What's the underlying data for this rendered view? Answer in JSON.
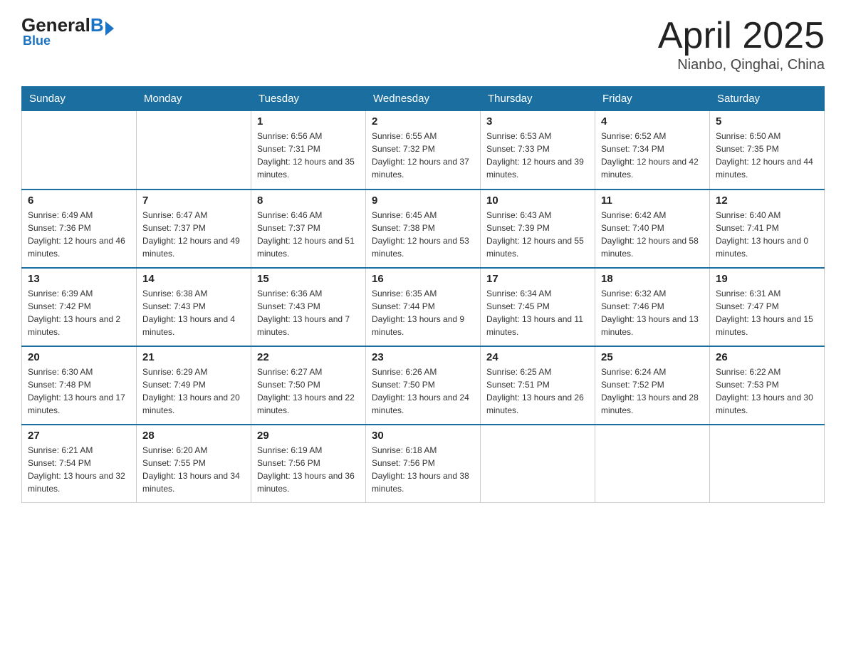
{
  "logo": {
    "name_black": "General",
    "name_blue": "Blue",
    "subtitle": "Blue"
  },
  "calendar": {
    "title": "April 2025",
    "subtitle": "Nianbo, Qinghai, China"
  },
  "headers": [
    "Sunday",
    "Monday",
    "Tuesday",
    "Wednesday",
    "Thursday",
    "Friday",
    "Saturday"
  ],
  "weeks": [
    [
      {
        "day": "",
        "sunrise": "",
        "sunset": "",
        "daylight": ""
      },
      {
        "day": "",
        "sunrise": "",
        "sunset": "",
        "daylight": ""
      },
      {
        "day": "1",
        "sunrise": "Sunrise: 6:56 AM",
        "sunset": "Sunset: 7:31 PM",
        "daylight": "Daylight: 12 hours and 35 minutes."
      },
      {
        "day": "2",
        "sunrise": "Sunrise: 6:55 AM",
        "sunset": "Sunset: 7:32 PM",
        "daylight": "Daylight: 12 hours and 37 minutes."
      },
      {
        "day": "3",
        "sunrise": "Sunrise: 6:53 AM",
        "sunset": "Sunset: 7:33 PM",
        "daylight": "Daylight: 12 hours and 39 minutes."
      },
      {
        "day": "4",
        "sunrise": "Sunrise: 6:52 AM",
        "sunset": "Sunset: 7:34 PM",
        "daylight": "Daylight: 12 hours and 42 minutes."
      },
      {
        "day": "5",
        "sunrise": "Sunrise: 6:50 AM",
        "sunset": "Sunset: 7:35 PM",
        "daylight": "Daylight: 12 hours and 44 minutes."
      }
    ],
    [
      {
        "day": "6",
        "sunrise": "Sunrise: 6:49 AM",
        "sunset": "Sunset: 7:36 PM",
        "daylight": "Daylight: 12 hours and 46 minutes."
      },
      {
        "day": "7",
        "sunrise": "Sunrise: 6:47 AM",
        "sunset": "Sunset: 7:37 PM",
        "daylight": "Daylight: 12 hours and 49 minutes."
      },
      {
        "day": "8",
        "sunrise": "Sunrise: 6:46 AM",
        "sunset": "Sunset: 7:37 PM",
        "daylight": "Daylight: 12 hours and 51 minutes."
      },
      {
        "day": "9",
        "sunrise": "Sunrise: 6:45 AM",
        "sunset": "Sunset: 7:38 PM",
        "daylight": "Daylight: 12 hours and 53 minutes."
      },
      {
        "day": "10",
        "sunrise": "Sunrise: 6:43 AM",
        "sunset": "Sunset: 7:39 PM",
        "daylight": "Daylight: 12 hours and 55 minutes."
      },
      {
        "day": "11",
        "sunrise": "Sunrise: 6:42 AM",
        "sunset": "Sunset: 7:40 PM",
        "daylight": "Daylight: 12 hours and 58 minutes."
      },
      {
        "day": "12",
        "sunrise": "Sunrise: 6:40 AM",
        "sunset": "Sunset: 7:41 PM",
        "daylight": "Daylight: 13 hours and 0 minutes."
      }
    ],
    [
      {
        "day": "13",
        "sunrise": "Sunrise: 6:39 AM",
        "sunset": "Sunset: 7:42 PM",
        "daylight": "Daylight: 13 hours and 2 minutes."
      },
      {
        "day": "14",
        "sunrise": "Sunrise: 6:38 AM",
        "sunset": "Sunset: 7:43 PM",
        "daylight": "Daylight: 13 hours and 4 minutes."
      },
      {
        "day": "15",
        "sunrise": "Sunrise: 6:36 AM",
        "sunset": "Sunset: 7:43 PM",
        "daylight": "Daylight: 13 hours and 7 minutes."
      },
      {
        "day": "16",
        "sunrise": "Sunrise: 6:35 AM",
        "sunset": "Sunset: 7:44 PM",
        "daylight": "Daylight: 13 hours and 9 minutes."
      },
      {
        "day": "17",
        "sunrise": "Sunrise: 6:34 AM",
        "sunset": "Sunset: 7:45 PM",
        "daylight": "Daylight: 13 hours and 11 minutes."
      },
      {
        "day": "18",
        "sunrise": "Sunrise: 6:32 AM",
        "sunset": "Sunset: 7:46 PM",
        "daylight": "Daylight: 13 hours and 13 minutes."
      },
      {
        "day": "19",
        "sunrise": "Sunrise: 6:31 AM",
        "sunset": "Sunset: 7:47 PM",
        "daylight": "Daylight: 13 hours and 15 minutes."
      }
    ],
    [
      {
        "day": "20",
        "sunrise": "Sunrise: 6:30 AM",
        "sunset": "Sunset: 7:48 PM",
        "daylight": "Daylight: 13 hours and 17 minutes."
      },
      {
        "day": "21",
        "sunrise": "Sunrise: 6:29 AM",
        "sunset": "Sunset: 7:49 PM",
        "daylight": "Daylight: 13 hours and 20 minutes."
      },
      {
        "day": "22",
        "sunrise": "Sunrise: 6:27 AM",
        "sunset": "Sunset: 7:50 PM",
        "daylight": "Daylight: 13 hours and 22 minutes."
      },
      {
        "day": "23",
        "sunrise": "Sunrise: 6:26 AM",
        "sunset": "Sunset: 7:50 PM",
        "daylight": "Daylight: 13 hours and 24 minutes."
      },
      {
        "day": "24",
        "sunrise": "Sunrise: 6:25 AM",
        "sunset": "Sunset: 7:51 PM",
        "daylight": "Daylight: 13 hours and 26 minutes."
      },
      {
        "day": "25",
        "sunrise": "Sunrise: 6:24 AM",
        "sunset": "Sunset: 7:52 PM",
        "daylight": "Daylight: 13 hours and 28 minutes."
      },
      {
        "day": "26",
        "sunrise": "Sunrise: 6:22 AM",
        "sunset": "Sunset: 7:53 PM",
        "daylight": "Daylight: 13 hours and 30 minutes."
      }
    ],
    [
      {
        "day": "27",
        "sunrise": "Sunrise: 6:21 AM",
        "sunset": "Sunset: 7:54 PM",
        "daylight": "Daylight: 13 hours and 32 minutes."
      },
      {
        "day": "28",
        "sunrise": "Sunrise: 6:20 AM",
        "sunset": "Sunset: 7:55 PM",
        "daylight": "Daylight: 13 hours and 34 minutes."
      },
      {
        "day": "29",
        "sunrise": "Sunrise: 6:19 AM",
        "sunset": "Sunset: 7:56 PM",
        "daylight": "Daylight: 13 hours and 36 minutes."
      },
      {
        "day": "30",
        "sunrise": "Sunrise: 6:18 AM",
        "sunset": "Sunset: 7:56 PM",
        "daylight": "Daylight: 13 hours and 38 minutes."
      },
      {
        "day": "",
        "sunrise": "",
        "sunset": "",
        "daylight": ""
      },
      {
        "day": "",
        "sunrise": "",
        "sunset": "",
        "daylight": ""
      },
      {
        "day": "",
        "sunrise": "",
        "sunset": "",
        "daylight": ""
      }
    ]
  ]
}
